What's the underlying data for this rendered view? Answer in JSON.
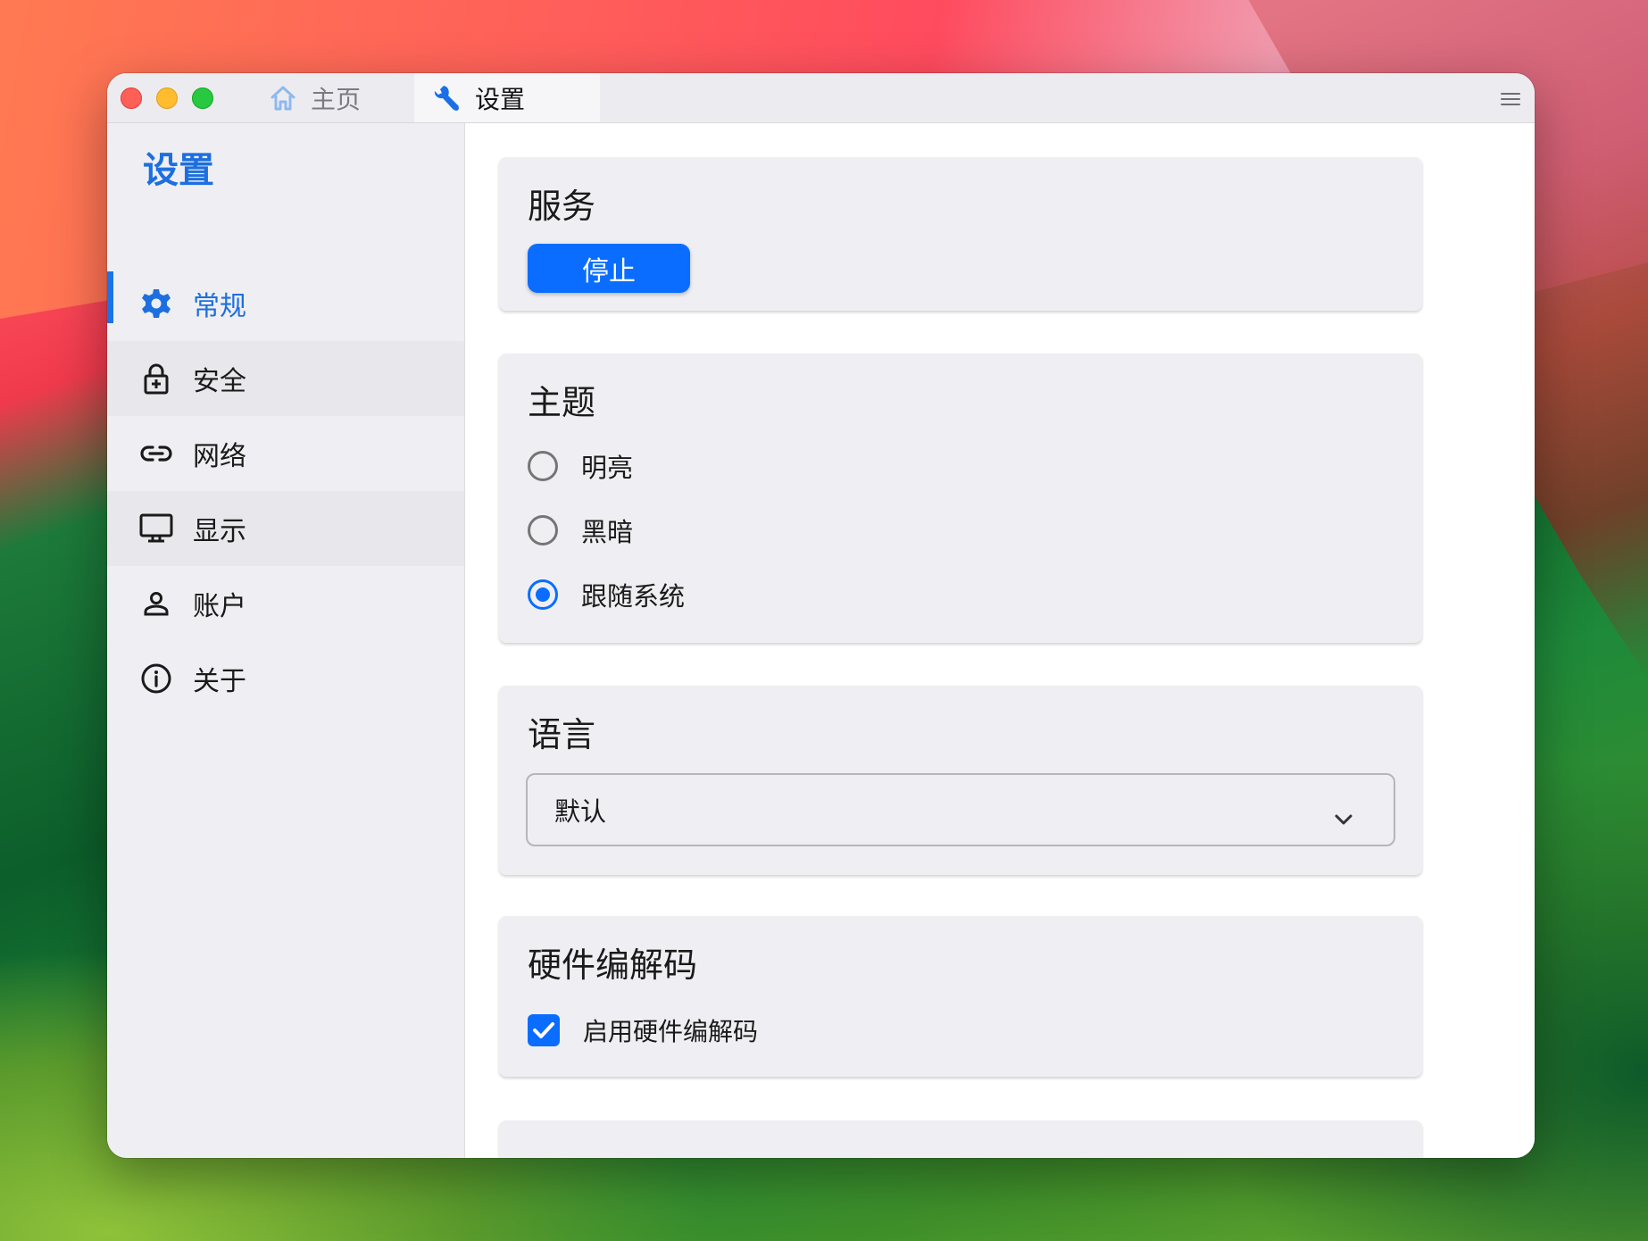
{
  "window": {
    "tabs": [
      {
        "label": "主页",
        "icon": "home-icon"
      },
      {
        "label": "设置",
        "icon": "wrench-icon"
      }
    ]
  },
  "sidebar": {
    "title": "设置",
    "items": [
      {
        "label": "常规",
        "icon": "gear-icon",
        "active": true
      },
      {
        "label": "安全",
        "icon": "lock-icon"
      },
      {
        "label": "网络",
        "icon": "link-icon"
      },
      {
        "label": "显示",
        "icon": "monitor-icon"
      },
      {
        "label": "账户",
        "icon": "person-icon"
      },
      {
        "label": "关于",
        "icon": "info-icon"
      }
    ]
  },
  "service": {
    "title": "服务",
    "button_label": "停止"
  },
  "theme": {
    "title": "主题",
    "options": [
      {
        "label": "明亮",
        "checked": false
      },
      {
        "label": "黑暗",
        "checked": false
      },
      {
        "label": "跟随系统",
        "checked": true
      }
    ]
  },
  "language": {
    "title": "语言",
    "selected": "默认"
  },
  "hwcodec": {
    "title": "硬件编解码",
    "checkbox_label": "启用硬件编解码",
    "checked": true
  },
  "colors": {
    "accent": "#0a6dff",
    "sidebar_active": "#1d6fe0"
  }
}
